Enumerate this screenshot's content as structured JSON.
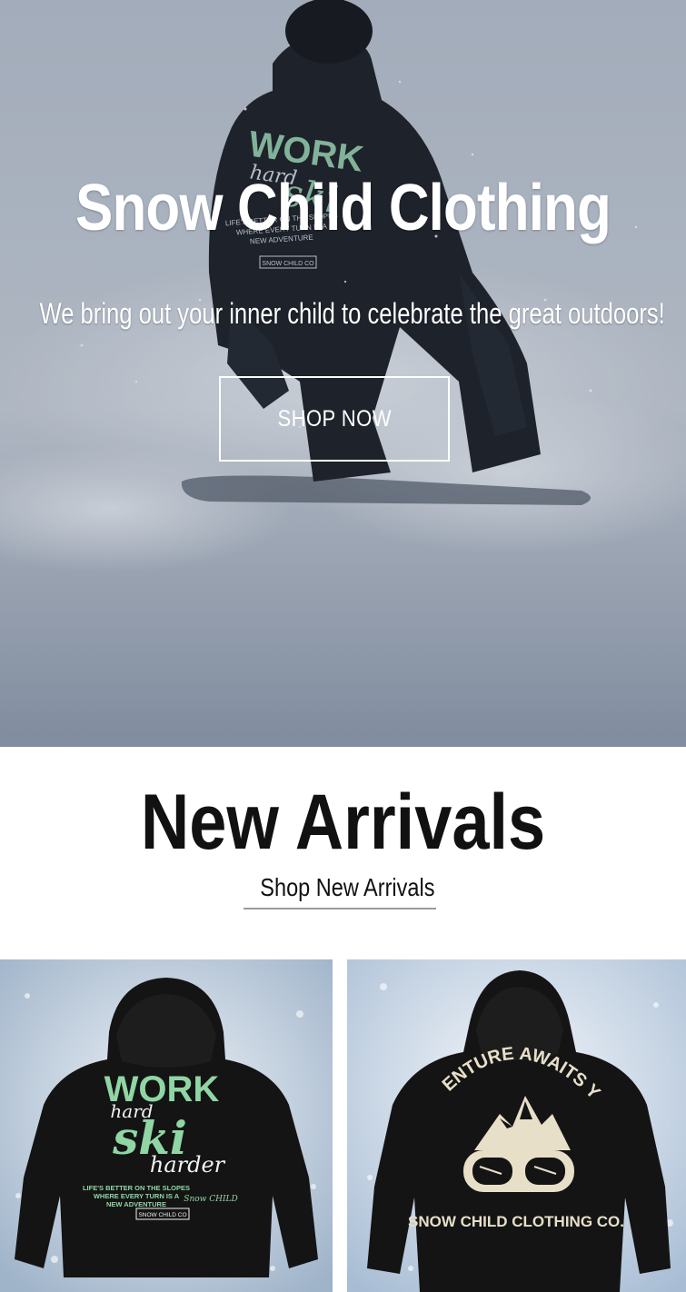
{
  "hero": {
    "title": "Snow Child Clothing",
    "subtitle": "We bring out your inner child to celebrate the great outdoors!",
    "cta_label": "SHOP NOW",
    "jacket_print": {
      "line1": "WORK",
      "line2": "hard",
      "line3": "ski",
      "small1": "LIFE'S BETTER ON THE SLOPES",
      "small2": "WHERE EVERY TURN IS A",
      "small3": "NEW ADVENTURE",
      "tag": "SNOW CHILD CO"
    }
  },
  "arrivals": {
    "title": "New Arrivals",
    "link_label": "Shop New Arrivals",
    "products": [
      {
        "print": {
          "line1": "WORK",
          "line2": "hard",
          "line3": "ski",
          "line4": "harder",
          "small1": "LIFE'S BETTER ON THE SLOPES",
          "small2": "WHERE EVERY TURN IS A",
          "small3": "NEW ADVENTURE",
          "brand": "Snow CHILD",
          "tag": "SNOW CHILD CO"
        }
      },
      {
        "print": {
          "arc_text": "ADVENTURE AWAITS YOU",
          "bottom_text": "SNOW CHILD CLOTHING CO."
        }
      }
    ]
  },
  "colors": {
    "accent_mint": "#8fd6a4",
    "cream_print": "#e7dfc8",
    "hoodie_black": "#141414",
    "text_dark": "#111111",
    "white": "#ffffff"
  }
}
